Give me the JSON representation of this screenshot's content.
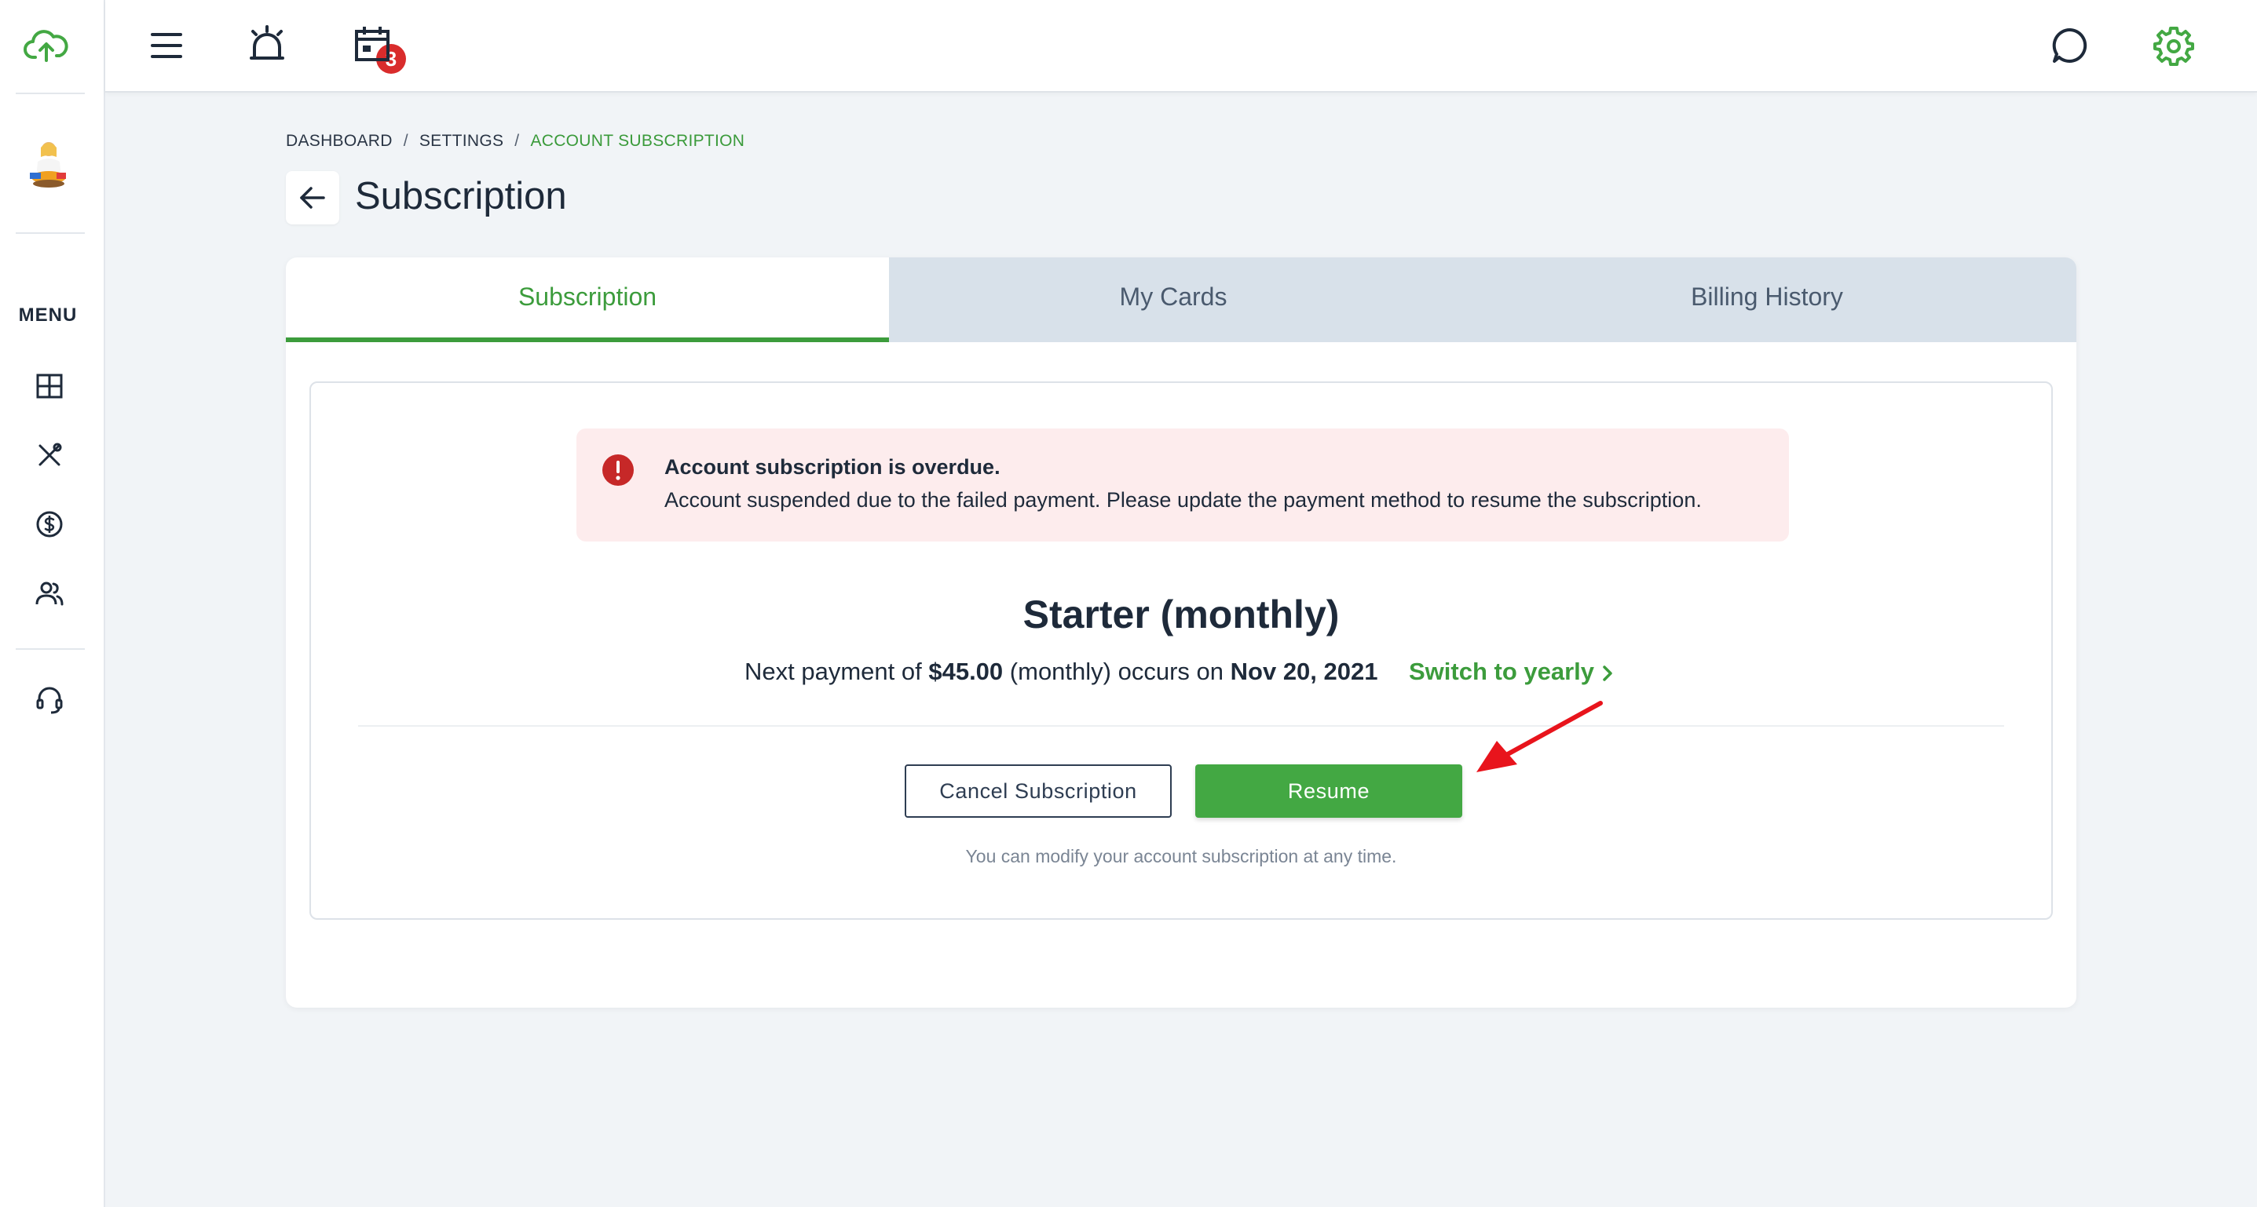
{
  "topbar": {
    "notification_count": "3"
  },
  "sidebar": {
    "menu_label": "MENU"
  },
  "breadcrumb": {
    "items": [
      "DASHBOARD",
      "SETTINGS",
      "ACCOUNT SUBSCRIPTION"
    ],
    "separator": "/"
  },
  "page": {
    "title": "Subscription"
  },
  "tabs": [
    {
      "label": "Subscription",
      "active": true
    },
    {
      "label": "My Cards",
      "active": false
    },
    {
      "label": "Billing History",
      "active": false
    }
  ],
  "alert": {
    "title": "Account subscription is overdue.",
    "message": "Account suspended due to the failed payment. Please update the payment method to resume the subscription."
  },
  "plan": {
    "name": "Starter (monthly)",
    "payment_prefix": "Next payment of",
    "amount": "$45.00",
    "period": "(monthly) occurs on",
    "date": "Nov 20, 2021",
    "switch_label": "Switch to yearly"
  },
  "actions": {
    "cancel_label": "Cancel Subscription",
    "resume_label": "Resume",
    "hint": "You can modify your account subscription at any time."
  },
  "colors": {
    "accent": "#43a843",
    "alert_bg": "#fdeced",
    "alert_icon": "#c62828",
    "annotation_arrow": "#e8141c"
  },
  "icons": [
    "cloud-upload-icon",
    "avatar-icon",
    "dashboard-icon",
    "tools-icon",
    "dollar-icon",
    "users-icon",
    "headset-icon",
    "menu-icon",
    "alarm-icon",
    "calendar-icon",
    "chat-icon",
    "gear-icon",
    "back-arrow-icon",
    "error-icon",
    "chevron-right-icon",
    "red-arrow-annotation-icon"
  ]
}
